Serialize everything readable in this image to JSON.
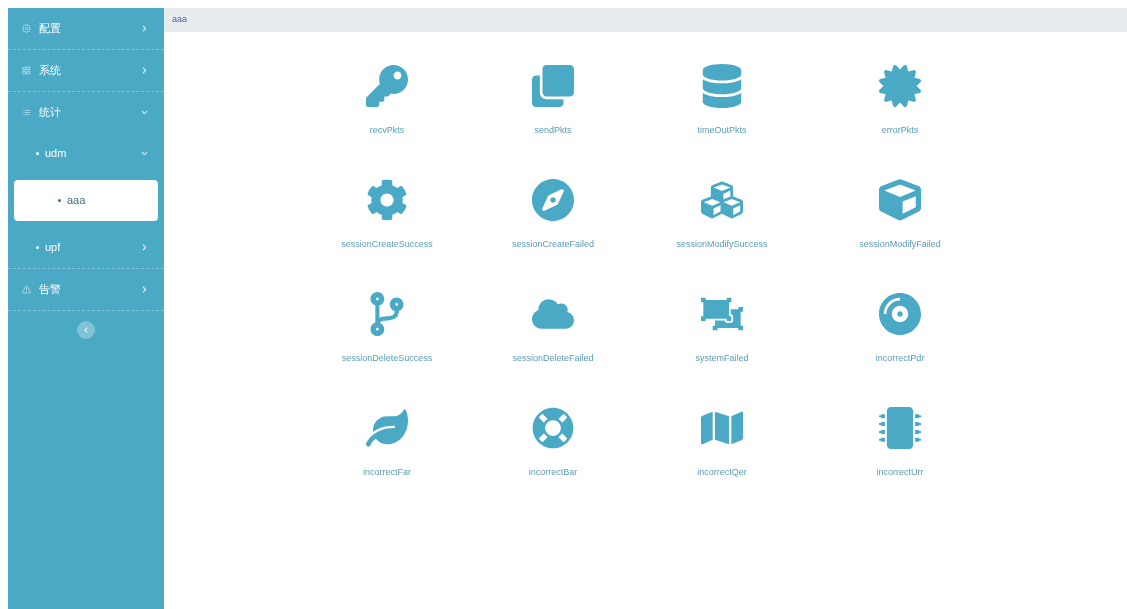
{
  "menu": [
    {
      "label": "配置",
      "expanded": false,
      "selected": false
    },
    {
      "label": "系统",
      "expanded": false,
      "selected": false
    },
    {
      "label": "统计",
      "expanded": true,
      "selected": false,
      "children": [
        {
          "label": "udm",
          "expanded": true,
          "selected": false,
          "children": [
            {
              "label": "aaa",
              "selected": true
            }
          ]
        },
        {
          "label": "upf",
          "expanded": false,
          "selected": false
        }
      ]
    },
    {
      "label": "告警",
      "expanded": false,
      "selected": false
    }
  ],
  "breadcrumb": "aaa",
  "tiles": [
    {
      "label": "recvPkts"
    },
    {
      "label": "sendPkts"
    },
    {
      "label": "timeOutPkts"
    },
    {
      "label": "errorPkts"
    },
    {
      "label": "sessionCreateSuccess"
    },
    {
      "label": "sessionCreateFailed"
    },
    {
      "label": "sessionModifySuccess"
    },
    {
      "label": "sessionModifyFailed"
    },
    {
      "label": "sessionDeleteSuccess"
    },
    {
      "label": "sessionDeleteFailed"
    },
    {
      "label": "systemFailed"
    },
    {
      "label": "incorrectPdr"
    },
    {
      "label": "incorrectFar"
    },
    {
      "label": "incorrectBar"
    },
    {
      "label": "incorrectQer"
    },
    {
      "label": "incorrectUrr"
    }
  ]
}
